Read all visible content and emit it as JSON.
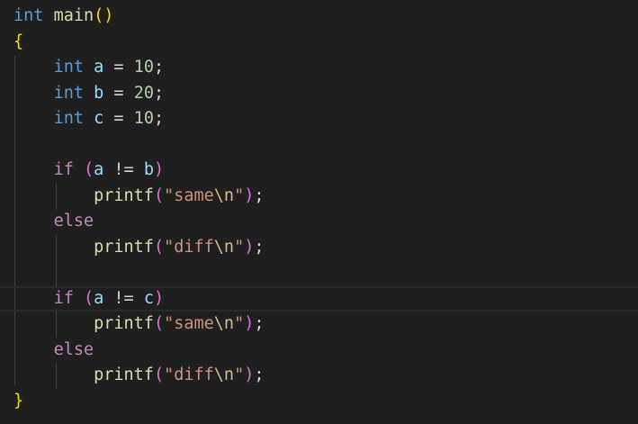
{
  "editor": {
    "lines": [
      {
        "tokens": [
          {
            "t": "int",
            "c": "kw-type"
          },
          {
            "t": " ",
            "c": ""
          },
          {
            "t": "main",
            "c": "fn"
          },
          {
            "t": "()",
            "c": "br1"
          }
        ]
      },
      {
        "tokens": [
          {
            "t": "{",
            "c": "br1"
          }
        ]
      },
      {
        "tokens": [
          {
            "t": "    ",
            "c": ""
          },
          {
            "t": "int",
            "c": "kw-type"
          },
          {
            "t": " ",
            "c": ""
          },
          {
            "t": "a",
            "c": "var"
          },
          {
            "t": " = ",
            "c": "op"
          },
          {
            "t": "10",
            "c": "num"
          },
          {
            "t": ";",
            "c": "op"
          }
        ]
      },
      {
        "tokens": [
          {
            "t": "    ",
            "c": ""
          },
          {
            "t": "int",
            "c": "kw-type"
          },
          {
            "t": " ",
            "c": ""
          },
          {
            "t": "b",
            "c": "var"
          },
          {
            "t": " = ",
            "c": "op"
          },
          {
            "t": "20",
            "c": "num"
          },
          {
            "t": ";",
            "c": "op"
          }
        ]
      },
      {
        "tokens": [
          {
            "t": "    ",
            "c": ""
          },
          {
            "t": "int",
            "c": "kw-type"
          },
          {
            "t": " ",
            "c": ""
          },
          {
            "t": "c",
            "c": "var"
          },
          {
            "t": " = ",
            "c": "op"
          },
          {
            "t": "10",
            "c": "num"
          },
          {
            "t": ";",
            "c": "op"
          }
        ]
      },
      {
        "tokens": []
      },
      {
        "tokens": [
          {
            "t": "    ",
            "c": ""
          },
          {
            "t": "if",
            "c": "kw-ctrl"
          },
          {
            "t": " ",
            "c": ""
          },
          {
            "t": "(",
            "c": "br2"
          },
          {
            "t": "a",
            "c": "var"
          },
          {
            "t": " != ",
            "c": "op"
          },
          {
            "t": "b",
            "c": "var"
          },
          {
            "t": ")",
            "c": "br2"
          }
        ]
      },
      {
        "tokens": [
          {
            "t": "        ",
            "c": ""
          },
          {
            "t": "printf",
            "c": "fn"
          },
          {
            "t": "(",
            "c": "br2"
          },
          {
            "t": "\"same",
            "c": "str"
          },
          {
            "t": "\\n",
            "c": "esc"
          },
          {
            "t": "\"",
            "c": "str"
          },
          {
            "t": ")",
            "c": "br2"
          },
          {
            "t": ";",
            "c": "op"
          }
        ]
      },
      {
        "tokens": [
          {
            "t": "    ",
            "c": ""
          },
          {
            "t": "else",
            "c": "kw-ctrl"
          }
        ]
      },
      {
        "tokens": [
          {
            "t": "        ",
            "c": ""
          },
          {
            "t": "printf",
            "c": "fn"
          },
          {
            "t": "(",
            "c": "br2"
          },
          {
            "t": "\"diff",
            "c": "str"
          },
          {
            "t": "\\n",
            "c": "esc"
          },
          {
            "t": "\"",
            "c": "str"
          },
          {
            "t": ")",
            "c": "br2"
          },
          {
            "t": ";",
            "c": "op"
          }
        ]
      },
      {
        "tokens": []
      },
      {
        "tokens": [
          {
            "t": "    ",
            "c": ""
          },
          {
            "t": "if",
            "c": "kw-ctrl"
          },
          {
            "t": " ",
            "c": ""
          },
          {
            "t": "(",
            "c": "br2"
          },
          {
            "t": "a",
            "c": "var"
          },
          {
            "t": " != ",
            "c": "op"
          },
          {
            "t": "c",
            "c": "var"
          },
          {
            "t": ")",
            "c": "br2"
          }
        ]
      },
      {
        "tokens": [
          {
            "t": "        ",
            "c": ""
          },
          {
            "t": "printf",
            "c": "fn"
          },
          {
            "t": "(",
            "c": "br2"
          },
          {
            "t": "\"same",
            "c": "str"
          },
          {
            "t": "\\n",
            "c": "esc"
          },
          {
            "t": "\"",
            "c": "str"
          },
          {
            "t": ")",
            "c": "br2"
          },
          {
            "t": ";",
            "c": "op"
          }
        ]
      },
      {
        "tokens": [
          {
            "t": "    ",
            "c": ""
          },
          {
            "t": "else",
            "c": "kw-ctrl"
          }
        ]
      },
      {
        "tokens": [
          {
            "t": "        ",
            "c": ""
          },
          {
            "t": "printf",
            "c": "fn"
          },
          {
            "t": "(",
            "c": "br2"
          },
          {
            "t": "\"diff",
            "c": "str"
          },
          {
            "t": "\\n",
            "c": "esc"
          },
          {
            "t": "\"",
            "c": "str"
          },
          {
            "t": ")",
            "c": "br2"
          },
          {
            "t": ";",
            "c": "op"
          }
        ]
      },
      {
        "tokens": [
          {
            "t": "}",
            "c": "br1"
          }
        ]
      }
    ],
    "current_line": 11
  }
}
